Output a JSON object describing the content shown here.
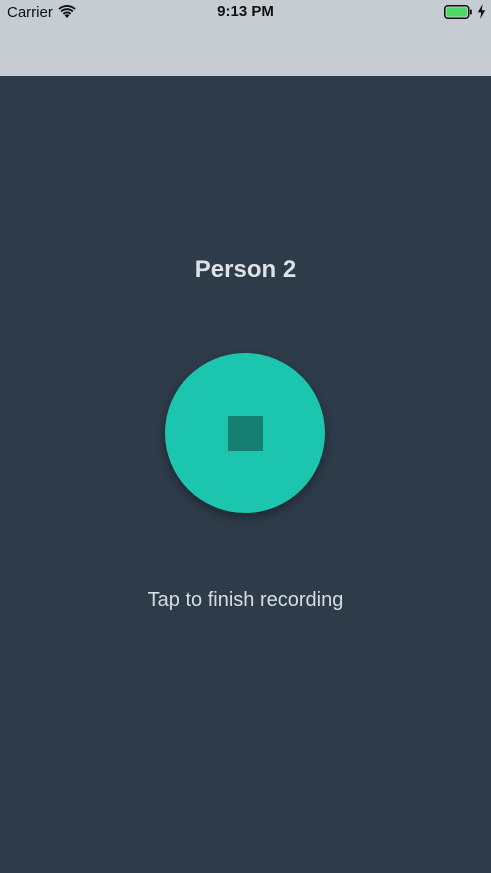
{
  "status_bar": {
    "carrier": "Carrier",
    "time": "9:13 PM",
    "wifi_icon": "wifi-icon",
    "battery_icon": "battery-icon",
    "charging_icon": "charging-bolt-icon",
    "battery_level": 1.0
  },
  "main": {
    "title": "Person 2",
    "record_button_icon": "stop-icon",
    "hint": "Tap to finish recording"
  },
  "colors": {
    "background": "#2e3b49",
    "status_bar": "#c5ccd2",
    "accent": "#1bc5ae",
    "stop_square": "#167f72",
    "battery_fill": "#4cd964"
  }
}
